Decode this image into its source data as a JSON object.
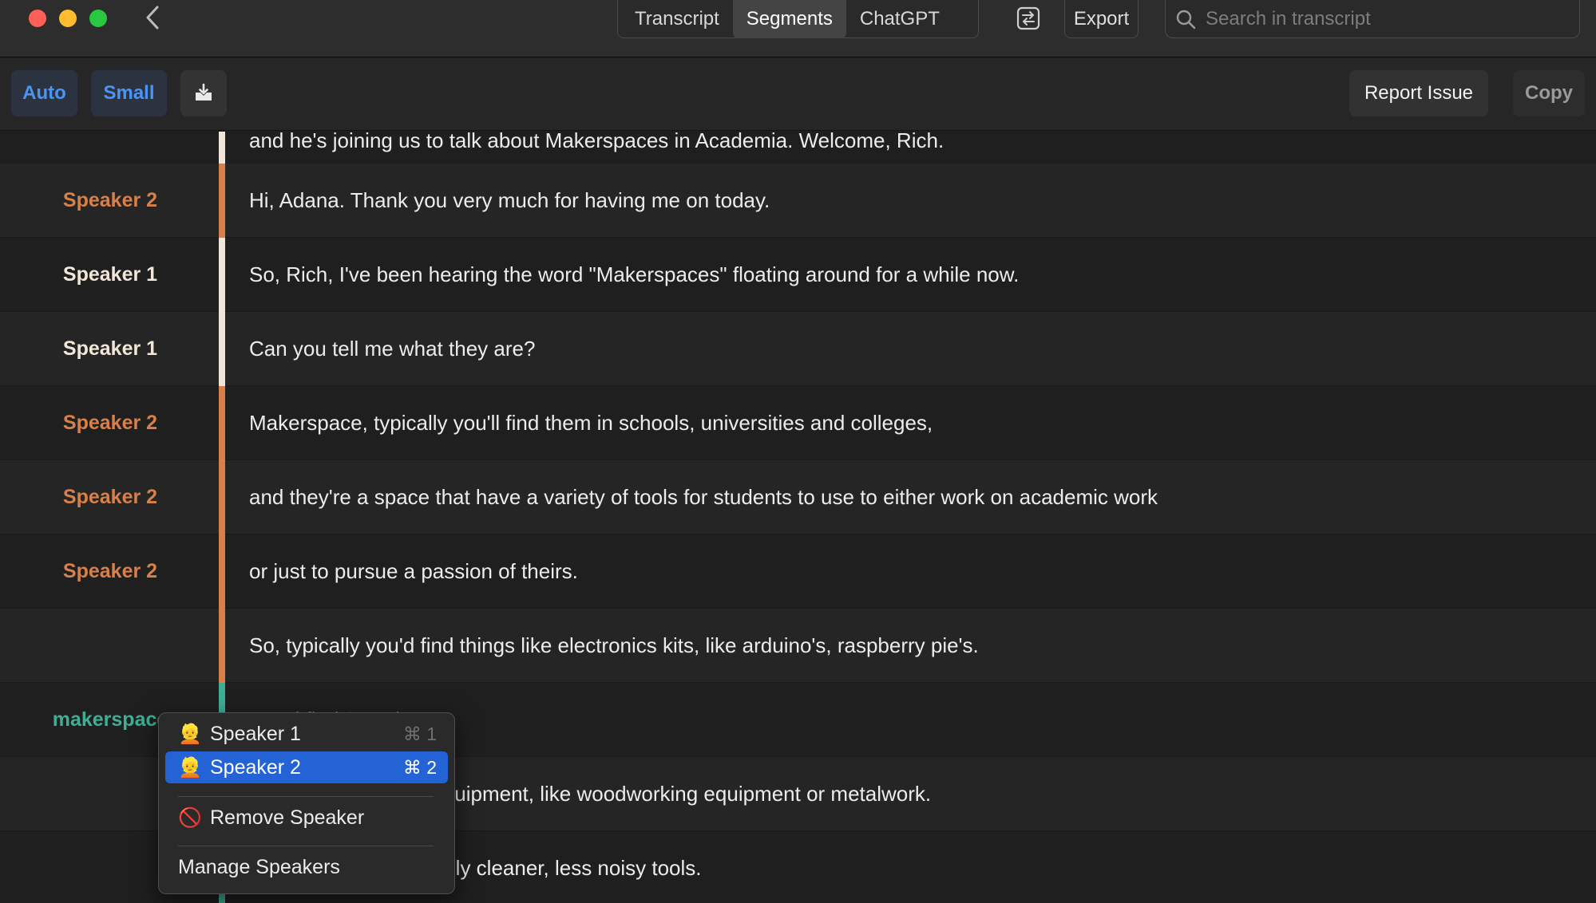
{
  "titlebar": {
    "tabs": [
      {
        "label": "Transcript",
        "active": false
      },
      {
        "label": "Segments",
        "active": true
      },
      {
        "label": "ChatGPT",
        "active": false
      }
    ],
    "export_label": "Export",
    "search_placeholder": "Search in transcript"
  },
  "toolbar": {
    "auto_label": "Auto",
    "small_label": "Small",
    "report_label": "Report Issue",
    "copy_label": "Copy"
  },
  "top_partial_text": "and he's joining us to talk about Makerspaces in Academia. Welcome, Rich.",
  "rows": [
    {
      "speaker": "Speaker 2",
      "text": "Hi, Adana. Thank you very much for having me on today."
    },
    {
      "speaker": "Speaker 1",
      "text": "So, Rich, I've been hearing the word \"Makerspaces\" floating around for a while now."
    },
    {
      "speaker": "Speaker 1",
      "text": "Can you tell me what they are?"
    },
    {
      "speaker": "Speaker 2",
      "text": "Makerspace, typically you'll find them in schools, universities and colleges,"
    },
    {
      "speaker": "Speaker 2",
      "text": "and they're a space that have a variety of tools for students to use to either work on academic work"
    },
    {
      "speaker": "Speaker 2",
      "text": "or just to pursue a passion of theirs."
    },
    {
      "speaker": "",
      "text": "So, typically you'd find things like electronics kits, like arduino's, raspberry pie's."
    },
    {
      "speaker": "makerspace",
      "text": "You'd find 3D printers."
    },
    {
      "speaker": "",
      "text": "Some include shop equipment, like woodworking equipment or metalwork."
    },
    {
      "speaker": "",
      "text": "Here in, we have mainly cleaner, less noisy tools."
    }
  ],
  "colors": {
    "speaker1": "#f2e6d9",
    "speaker2": "#d9804a",
    "makerspace": "#3fae94",
    "accent": "#2463d6"
  },
  "context_menu": {
    "items": [
      {
        "emoji": "👱",
        "label": "Speaker 1",
        "shortcut": "⌘ 1"
      },
      {
        "emoji": "👱",
        "label": "Speaker 2",
        "shortcut": "⌘ 2"
      },
      {
        "emoji": "🚫",
        "label": "Remove Speaker"
      },
      {
        "label": "Manage Speakers"
      }
    ]
  }
}
